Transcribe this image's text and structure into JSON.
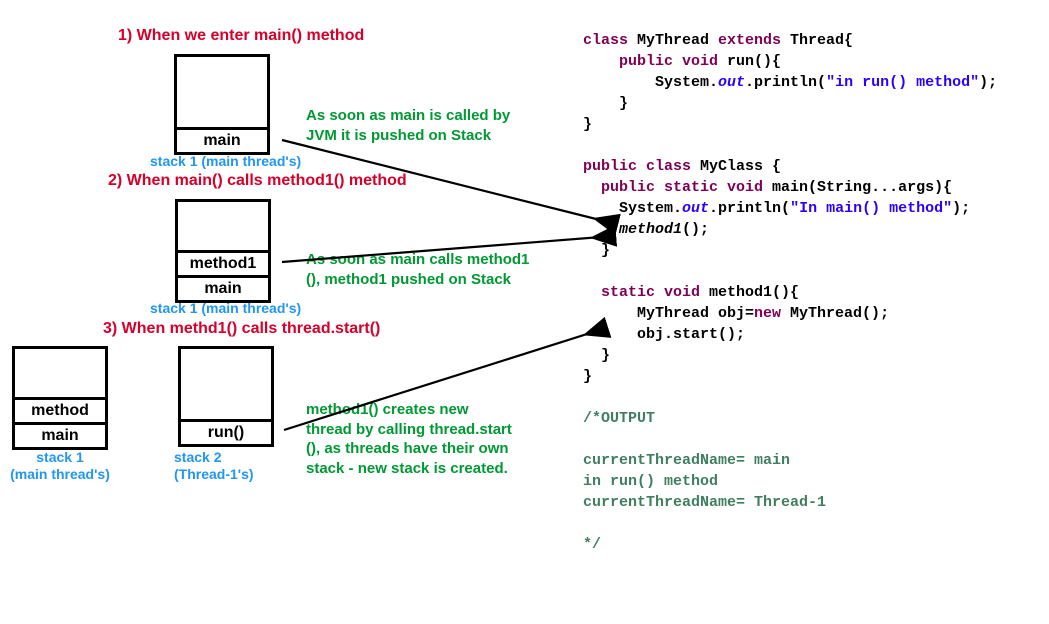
{
  "titles": {
    "t1": "1) When we enter main() method",
    "t2": "2) When main() calls method1() method",
    "t3": "3) When methd1() calls thread.start()"
  },
  "annotations": {
    "a1l1": "As soon as main is called by",
    "a1l2": "JVM it is pushed on Stack",
    "a2l1": "As soon as main calls method1",
    "a2l2": "(), method1  pushed on Stack",
    "a3l1": "method1() creates new",
    "a3l2": "thread by calling thread.start",
    "a3l3": "(), as threads have their own",
    "a3l4": "stack - new stack is created."
  },
  "captions": {
    "c1": "stack 1 (main thread's)",
    "c2": "stack 1 (main thread's)",
    "c3a_l1": "stack 1",
    "c3a_l2": "(main thread's)",
    "c3b_l1": "stack 2",
    "c3b_l2": "(Thread-1's)"
  },
  "stacks": {
    "s1": {
      "cells": [
        "main"
      ]
    },
    "s2": {
      "cells": [
        "method1",
        "main"
      ]
    },
    "s3a": {
      "cells": [
        "method",
        "main"
      ]
    },
    "s3b": {
      "cells": [
        "run()"
      ]
    }
  },
  "code": {
    "l01_a": "class",
    "l01_b": " MyThread ",
    "l01_c": "extends",
    "l01_d": " Thread{",
    "l02_a": "    ",
    "l02_b": "public void",
    "l02_c": " run(){",
    "l03_a": "        System.",
    "l03_b": "out",
    "l03_c": ".println(",
    "l03_d": "\"in run() method\"",
    "l03_e": ");",
    "l04": "    }",
    "l05": "}",
    "l07_a": "public class",
    "l07_b": " MyClass {",
    "l08_a": "  ",
    "l08_b": "public static void",
    "l08_c": " main(String...args){",
    "l09_a": "    System.",
    "l09_b": "out",
    "l09_c": ".println(",
    "l09_d": "\"In main() method\"",
    "l09_e": ");",
    "l10_a": "    ",
    "l10_b": "method1",
    "l10_c": "();",
    "l11": "  }",
    "l13_a": "  ",
    "l13_b": "static void",
    "l13_c": " method1(){",
    "l14_a": "      MyThread obj=",
    "l14_b": "new",
    "l14_c": " MyThread();",
    "l15": "      obj.start();",
    "l16": "  }",
    "l17": "}",
    "c1": "/*OUTPUT",
    "c3": "currentThreadName= main",
    "c4": "in run() method",
    "c5": "currentThreadName= Thread-1",
    "c7": "*/"
  }
}
